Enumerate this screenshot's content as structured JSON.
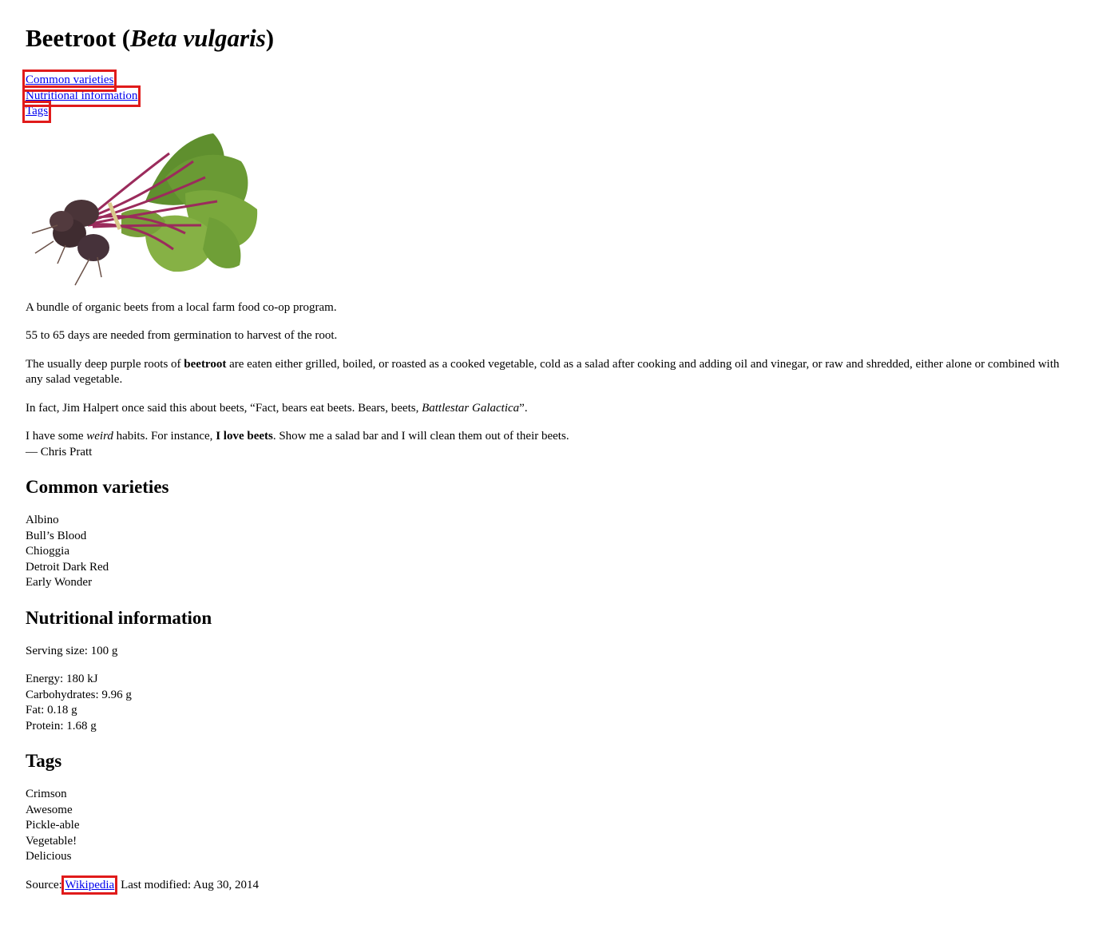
{
  "title": {
    "common": "Beetroot",
    "open": " (",
    "scientific": "Beta vulgaris",
    "close": ")"
  },
  "toc": [
    {
      "label": "Common varieties"
    },
    {
      "label": "Nutritional information"
    },
    {
      "label": "Tags"
    }
  ],
  "hero": {
    "icon": "beetroot-bundle-image"
  },
  "caption": "A bundle of organic beets from a local farm food co-op program.",
  "germination": "55 to 65 days are needed from germination to harvest of the root.",
  "usage": {
    "pre": "The usually deep purple roots of ",
    "bold": "beetroot",
    "post": " are eaten either grilled, boiled, or roasted as a cooked vegetable, cold as a salad after cooking and adding oil and vinegar, or raw and shredded, either alone or combined with any salad vegetable."
  },
  "halpert": {
    "pre": "In fact, Jim Halpert once said this about beets, “Fact, bears eat beets. Bears, beets, ",
    "italic": "Battlestar Galactica",
    "post": "”."
  },
  "pratt": {
    "pre": "I have some ",
    "italic": "weird",
    "mid": " habits. For instance, ",
    "bold": "I love beets",
    "post": ". Show me a salad bar and I will clean them out of their beets.",
    "author": "— Chris Pratt"
  },
  "varieties": {
    "heading": "Common varieties",
    "items": [
      "Albino",
      "Bull’s Blood",
      "Chioggia",
      "Detroit Dark Red",
      "Early Wonder"
    ]
  },
  "nutrition": {
    "heading": "Nutritional information",
    "serving": "Serving size: 100 g",
    "items": [
      "Energy: 180 kJ",
      "Carbohydrates: 9.96 g",
      "Fat: 0.18 g",
      "Protein: 1.68 g"
    ]
  },
  "tags": {
    "heading": "Tags",
    "items": [
      "Crimson",
      "Awesome",
      "Pickle-able",
      "Vegetable!",
      "Delicious"
    ]
  },
  "footer": {
    "source_label": "Source: ",
    "source_link": "Wikipedia",
    "modified": "; Last modified: Aug 30, 2014"
  },
  "colors": {
    "link": "#0000ee",
    "highlight": "#e01b1b"
  }
}
